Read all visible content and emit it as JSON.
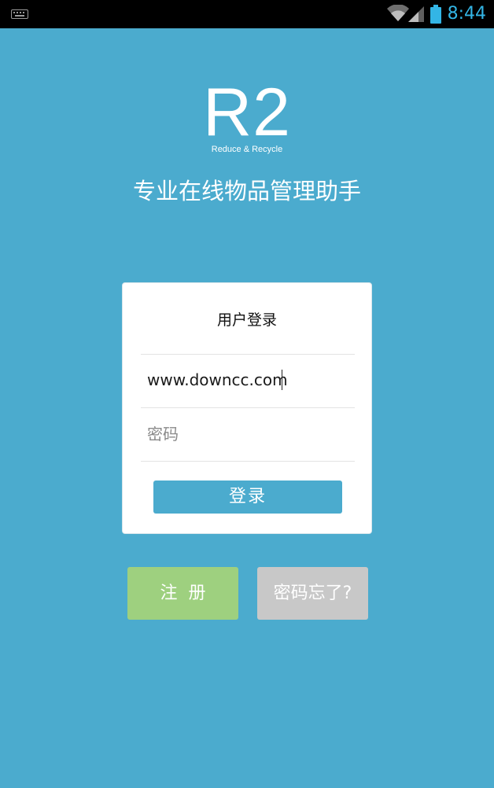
{
  "status_bar": {
    "time": "8:44",
    "icons": [
      "keyboard-icon",
      "wifi-icon",
      "signal-icon",
      "battery-icon"
    ],
    "time_color": "#33B5E5"
  },
  "brand": {
    "logo_mark": "R2",
    "logo_tagline": "Reduce & Recycle",
    "slogan": "专业在线物品管理助手"
  },
  "login_card": {
    "title": "用户登录",
    "username_value": "www.downcc.com",
    "password_placeholder": "密码",
    "login_label": "登录"
  },
  "actions": {
    "register_label": "注册",
    "forgot_label": "密码忘了?"
  },
  "colors": {
    "background": "#4BABCE",
    "register": "#9ED07F",
    "forgot": "#C8C8C8",
    "card": "#FFFFFF"
  }
}
